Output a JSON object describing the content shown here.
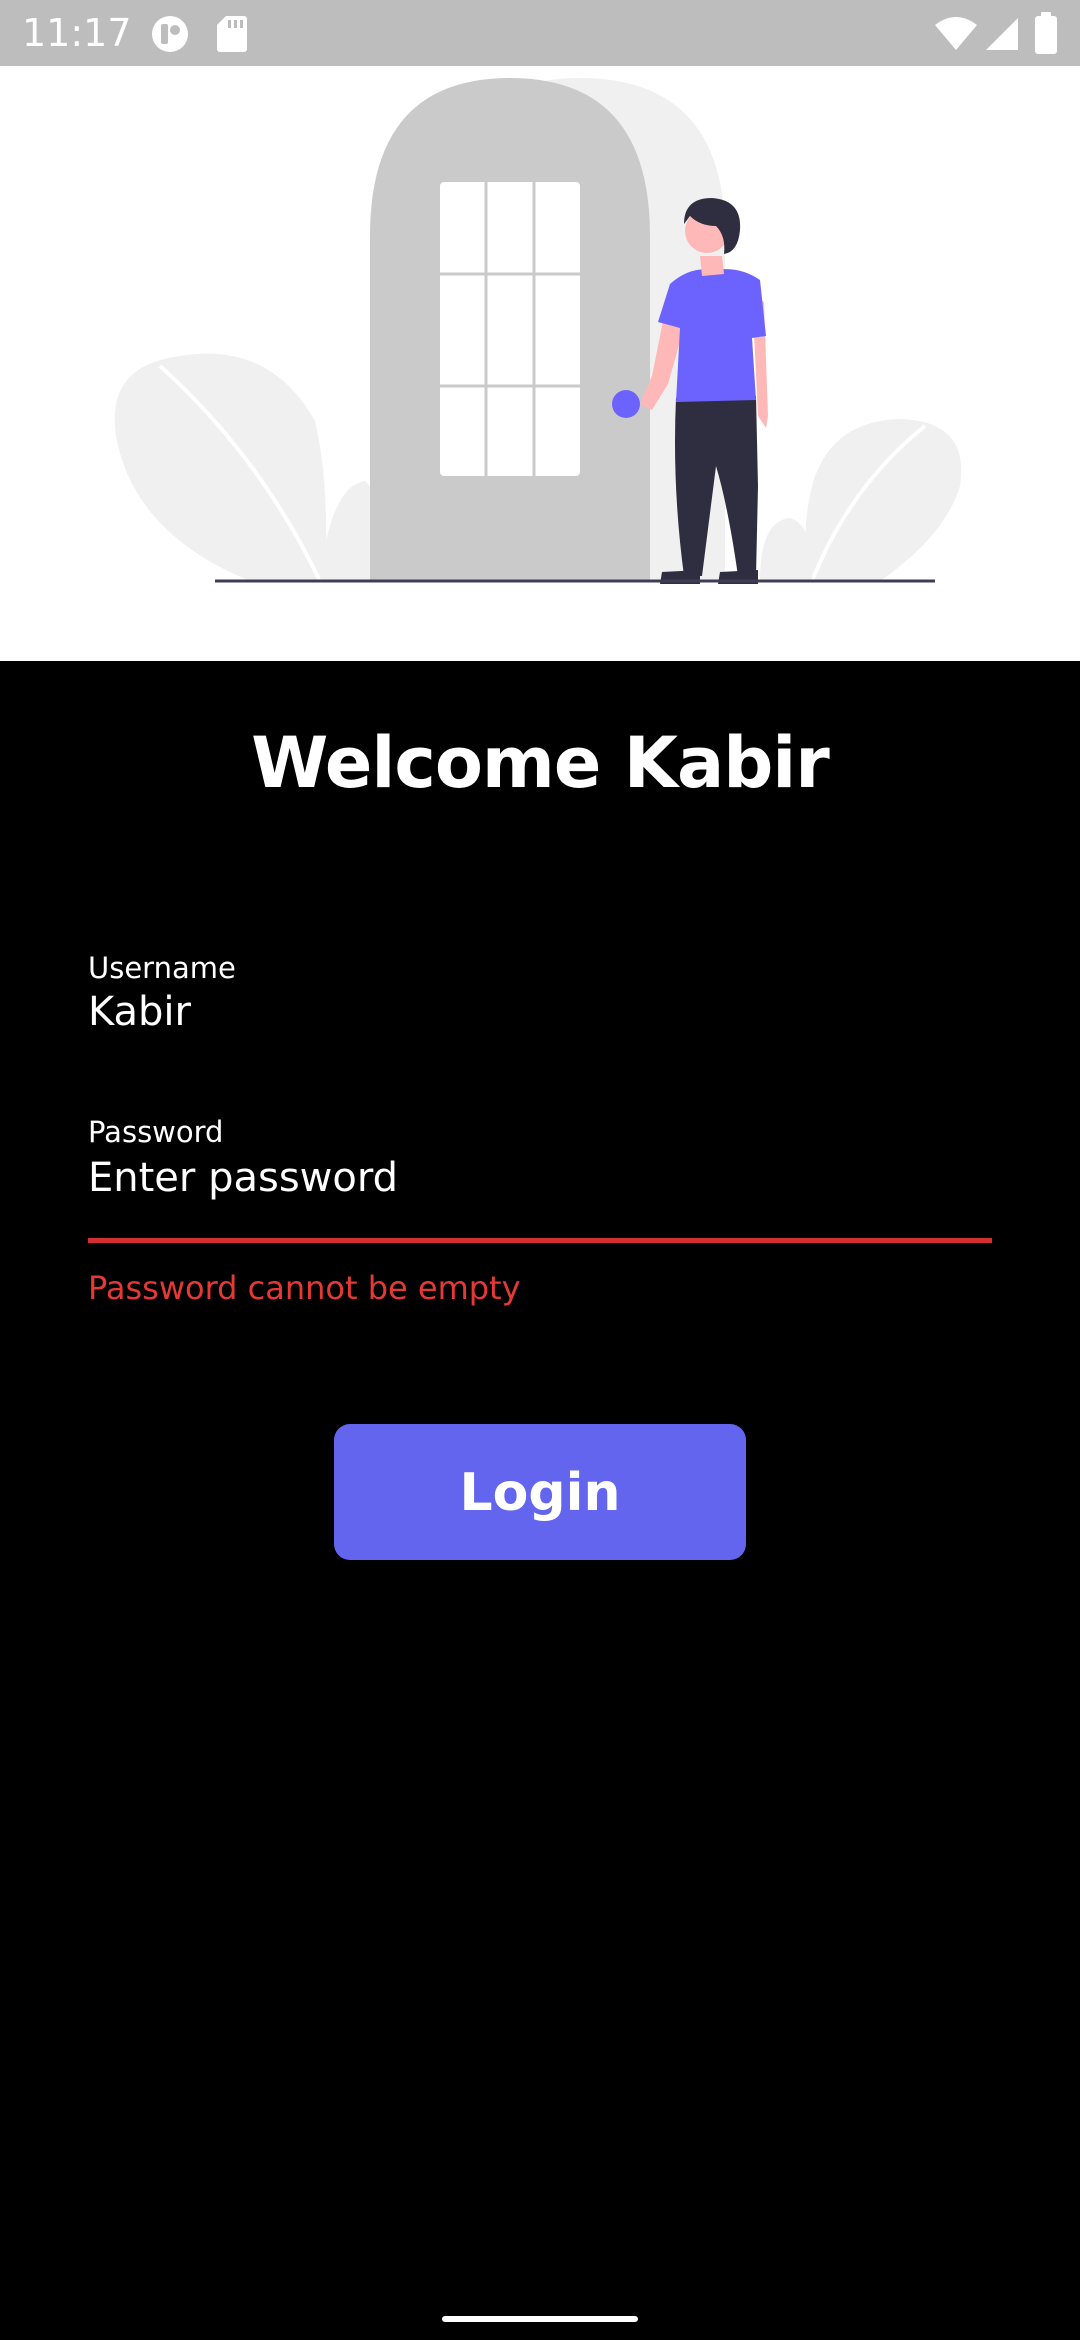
{
  "status_bar": {
    "time": "11:17",
    "icons": [
      "app-notification-icon",
      "sd-card-icon",
      "wifi-icon",
      "cellular-signal-icon",
      "battery-icon"
    ]
  },
  "hero": {
    "illustration": "person-at-door-illustration"
  },
  "login": {
    "title": "Welcome Kabir",
    "username": {
      "label": "Username",
      "value": "Kabir"
    },
    "password": {
      "label": "Password",
      "placeholder": "Enter password",
      "value": "",
      "error": "Password cannot be empty"
    },
    "submit_label": "Login"
  },
  "colors": {
    "accent": "#6365ef",
    "error": "#d32f2f",
    "background": "#000000",
    "hero_background": "#ffffff"
  }
}
